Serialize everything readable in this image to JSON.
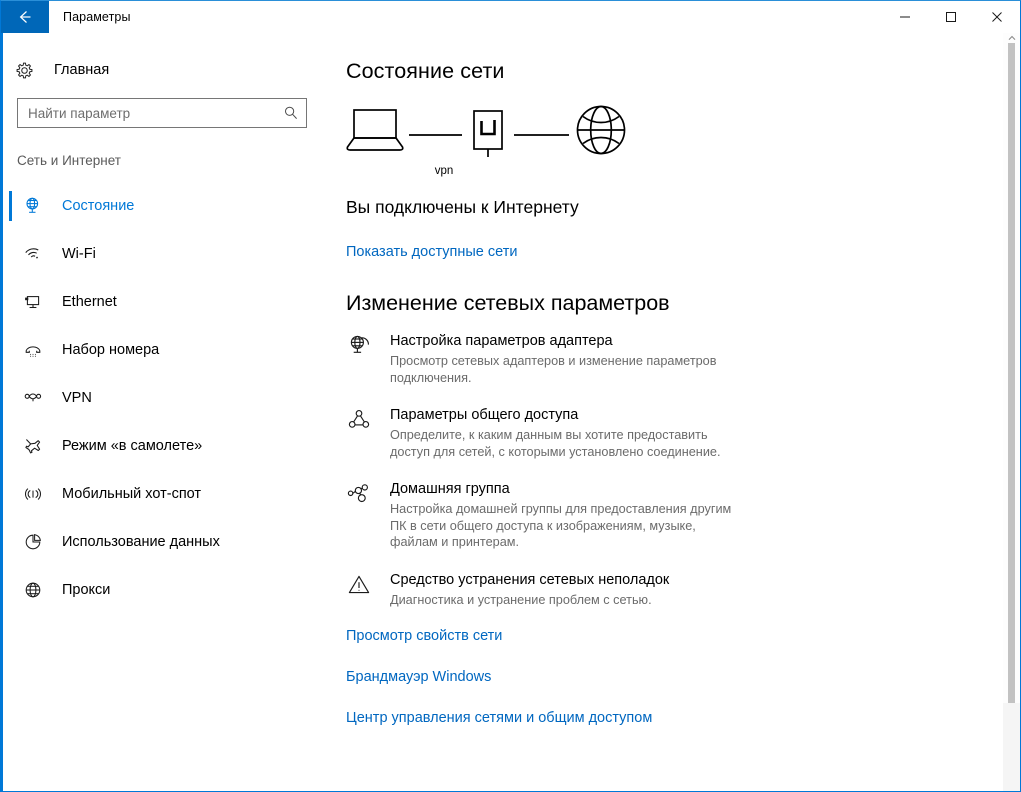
{
  "window": {
    "title": "Параметры",
    "back_icon": "back-arrow-icon",
    "minimize_label": "—",
    "maximize_label": "□",
    "close_label": "✕"
  },
  "sidebar": {
    "home": {
      "label": "Главная",
      "icon": "gear-icon"
    },
    "search": {
      "placeholder": "Найти параметр",
      "value": "",
      "icon": "search-icon"
    },
    "category": "Сеть и Интернет",
    "items": [
      {
        "label": "Состояние",
        "icon": "network-status-icon",
        "selected": true
      },
      {
        "label": "Wi-Fi",
        "icon": "wifi-icon",
        "selected": false
      },
      {
        "label": "Ethernet",
        "icon": "ethernet-icon",
        "selected": false
      },
      {
        "label": "Набор номера",
        "icon": "dial-up-icon",
        "selected": false
      },
      {
        "label": "VPN",
        "icon": "vpn-icon",
        "selected": false
      },
      {
        "label": "Режим «в самолете»",
        "icon": "airplane-icon",
        "selected": false
      },
      {
        "label": "Мобильный хот-спот",
        "icon": "hotspot-icon",
        "selected": false
      },
      {
        "label": "Использование данных",
        "icon": "data-usage-icon",
        "selected": false
      },
      {
        "label": "Прокси",
        "icon": "proxy-globe-icon",
        "selected": false
      }
    ]
  },
  "main": {
    "page_title": "Состояние сети",
    "diagram": {
      "device_icon": "laptop-icon",
      "middle_icon": "vpn-box-icon",
      "middle_label": "vpn",
      "internet_icon": "globe-icon"
    },
    "status_text": "Вы подключены к Интернету",
    "show_networks_link": "Показать доступные сети",
    "section_title": "Изменение сетевых параметров",
    "settings": [
      {
        "icon": "adapter-options-icon",
        "title": "Настройка параметров адаптера",
        "desc": "Просмотр сетевых адаптеров и изменение параметров подключения."
      },
      {
        "icon": "sharing-options-icon",
        "title": "Параметры общего доступа",
        "desc": "Определите, к каким данным вы хотите предоставить доступ для сетей, с которыми установлено соединение."
      },
      {
        "icon": "homegroup-icon",
        "title": "Домашняя группа",
        "desc": "Настройка домашней группы для предоставления другим ПК в сети общего доступа к изображениям, музыке, файлам и принтерам."
      },
      {
        "icon": "troubleshoot-warning-icon",
        "title": "Средство устранения сетевых неполадок",
        "desc": "Диагностика и устранение проблем с сетью."
      }
    ],
    "bottom_links": [
      "Просмотр свойств сети",
      "Брандмауэр Windows",
      "Центр управления сетями и общим доступом"
    ]
  },
  "colors": {
    "accent": "#0078d7",
    "back_button_bg": "#0067b8",
    "link": "#0067c0",
    "muted_text": "#6b6b6b",
    "scrollbar_thumb": "#c2c2c2"
  }
}
